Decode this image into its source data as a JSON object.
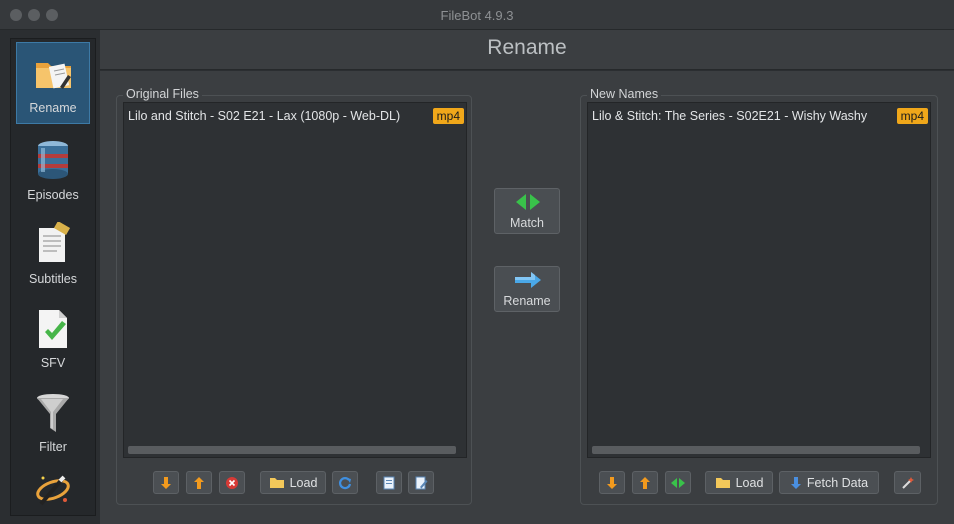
{
  "window": {
    "title": "FileBot 4.9.3"
  },
  "sidebar": {
    "items": [
      {
        "label": "Rename",
        "icon": "rename-folder-icon",
        "active": true
      },
      {
        "label": "Episodes",
        "icon": "database-icon",
        "active": false
      },
      {
        "label": "Subtitles",
        "icon": "subtitles-document-icon",
        "active": false
      },
      {
        "label": "SFV",
        "icon": "checkmark-document-icon",
        "active": false
      },
      {
        "label": "Filter",
        "icon": "funnel-icon",
        "active": false
      },
      {
        "label": "",
        "icon": "magic-wand-icon",
        "active": false
      }
    ]
  },
  "header": {
    "title": "Rename"
  },
  "original_files": {
    "title": "Original Files",
    "items": [
      {
        "name": "Lilo and Stitch - S02 E21 - Lax (1080p - Web-DL)",
        "ext": "mp4"
      }
    ],
    "toolbar": {
      "load_label": "Load"
    }
  },
  "new_names": {
    "title": "New Names",
    "items": [
      {
        "name": "Lilo & Stitch: The Series - S02E21 - Wishy Washy",
        "ext": "mp4"
      }
    ],
    "toolbar": {
      "load_label": "Load",
      "fetch_label": "Fetch Data"
    }
  },
  "actions": {
    "match_label": "Match",
    "rename_label": "Rename"
  },
  "colors": {
    "accent": "#2a5576",
    "badge": "#f0a71a",
    "arrow_orange": "#f29a1e",
    "match_green": "#39c24a",
    "rename_blue": "#4aa8e8"
  }
}
